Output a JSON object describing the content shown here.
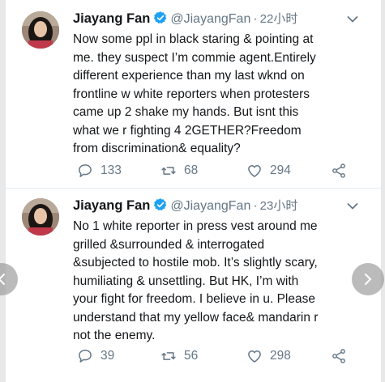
{
  "tweets": [
    {
      "name": "Jiayang Fan",
      "handle": "@JiayangFan",
      "time": "22小时",
      "lines": [
        "Now some ppl in black staring & pointing at",
        "me. they suspect I’m commie agent.Entirely",
        "different experience than my last wknd on",
        "frontline w white reporters when protesters",
        "came up 2 shake my hands. But isnt this",
        "what we r fighting 4 2GETHER?Freedom",
        "from discrimination& equality?"
      ],
      "replies": "133",
      "retweets": "68",
      "likes": "294"
    },
    {
      "name": "Jiayang Fan",
      "handle": "@JiayangFan",
      "time": "23小时",
      "lines": [
        "No 1 white reporter in press vest around me",
        "grilled &surrounded & interrogated",
        "&subjected to hostile mob. It’s slightly scary,",
        "humiliating & unsettling. But HK, I’m with",
        "your fight for freedom. I believe in u. Please",
        "understand that my yellow face& mandarin r",
        "not the enemy."
      ],
      "replies": "39",
      "retweets": "56",
      "likes": "298"
    }
  ],
  "icons": {
    "verified": "verified-badge-icon",
    "caret": "chevron-down-icon",
    "reply": "reply-icon",
    "retweet": "retweet-icon",
    "like": "heart-icon",
    "share": "share-icon",
    "prev": "chevron-left-icon",
    "next": "chevron-right-icon"
  },
  "colors": {
    "text": "#14171a",
    "secondary": "#657786",
    "verified": "#1da1f2",
    "divider": "#e6ecf0"
  }
}
